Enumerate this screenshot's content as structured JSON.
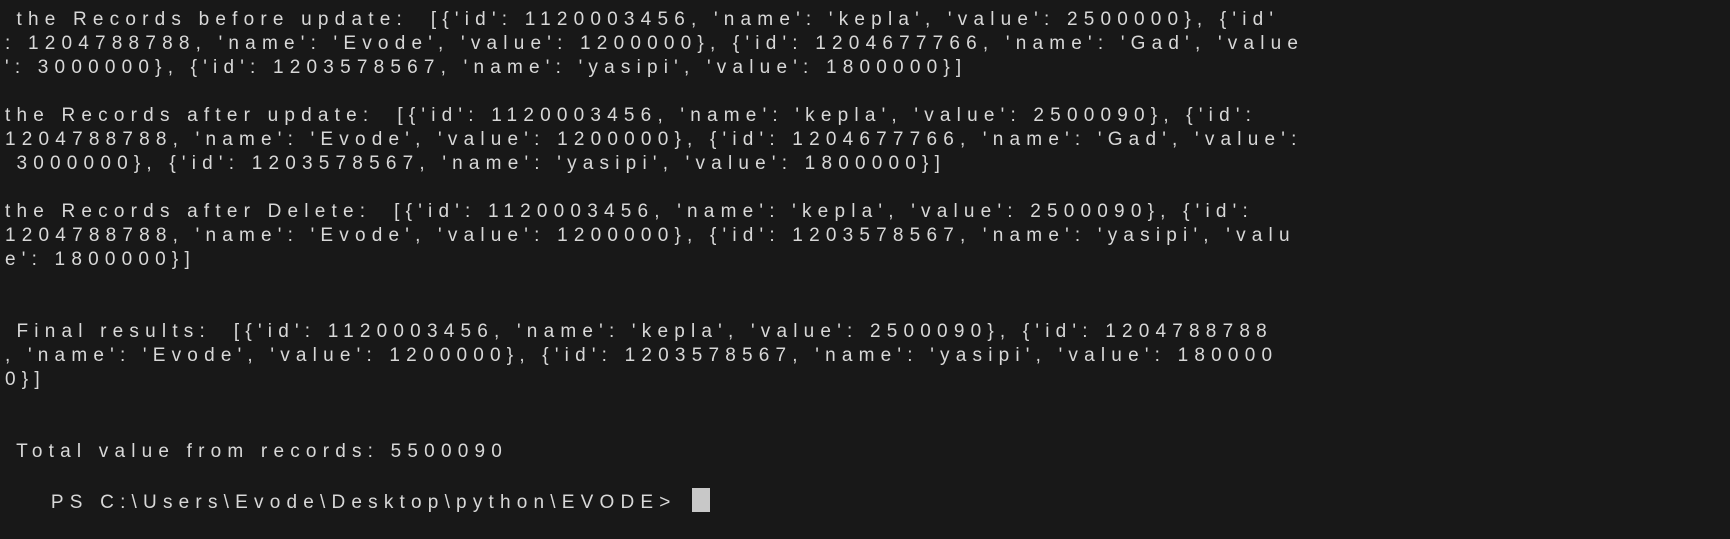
{
  "terminal": {
    "lines": [
      " the Records before update:  [{'id': 1120003456, 'name': 'kepla', 'value': 2500000}, {'id'",
      ": 1204788788, 'name': 'Evode', 'value': 1200000}, {'id': 1204677766, 'name': 'Gad', 'value",
      "': 3000000}, {'id': 1203578567, 'name': 'yasipi', 'value': 1800000}]",
      "",
      "the Records after update:  [{'id': 1120003456, 'name': 'kepla', 'value': 2500090}, {'id':",
      "1204788788, 'name': 'Evode', 'value': 1200000}, {'id': 1204677766, 'name': 'Gad', 'value':",
      " 3000000}, {'id': 1203578567, 'name': 'yasipi', 'value': 1800000}]",
      "",
      "the Records after Delete:  [{'id': 1120003456, 'name': 'kepla', 'value': 2500090}, {'id':",
      "1204788788, 'name': 'Evode', 'value': 1200000}, {'id': 1203578567, 'name': 'yasipi', 'valu",
      "e': 1800000}]",
      "",
      "",
      " Final results:  [{'id': 1120003456, 'name': 'kepla', 'value': 2500090}, {'id': 1204788788",
      ", 'name': 'Evode', 'value': 1200000}, {'id': 1203578567, 'name': 'yasipi', 'value': 180000",
      "0}]",
      "",
      "",
      " Total value from records: 5500090"
    ],
    "prompt": "PS C:\\Users\\Evode\\Desktop\\python\\EVODE> "
  },
  "colors": {
    "background": "#181818",
    "foreground": "#d8d8d8",
    "cursor": "#c8c8c8"
  }
}
